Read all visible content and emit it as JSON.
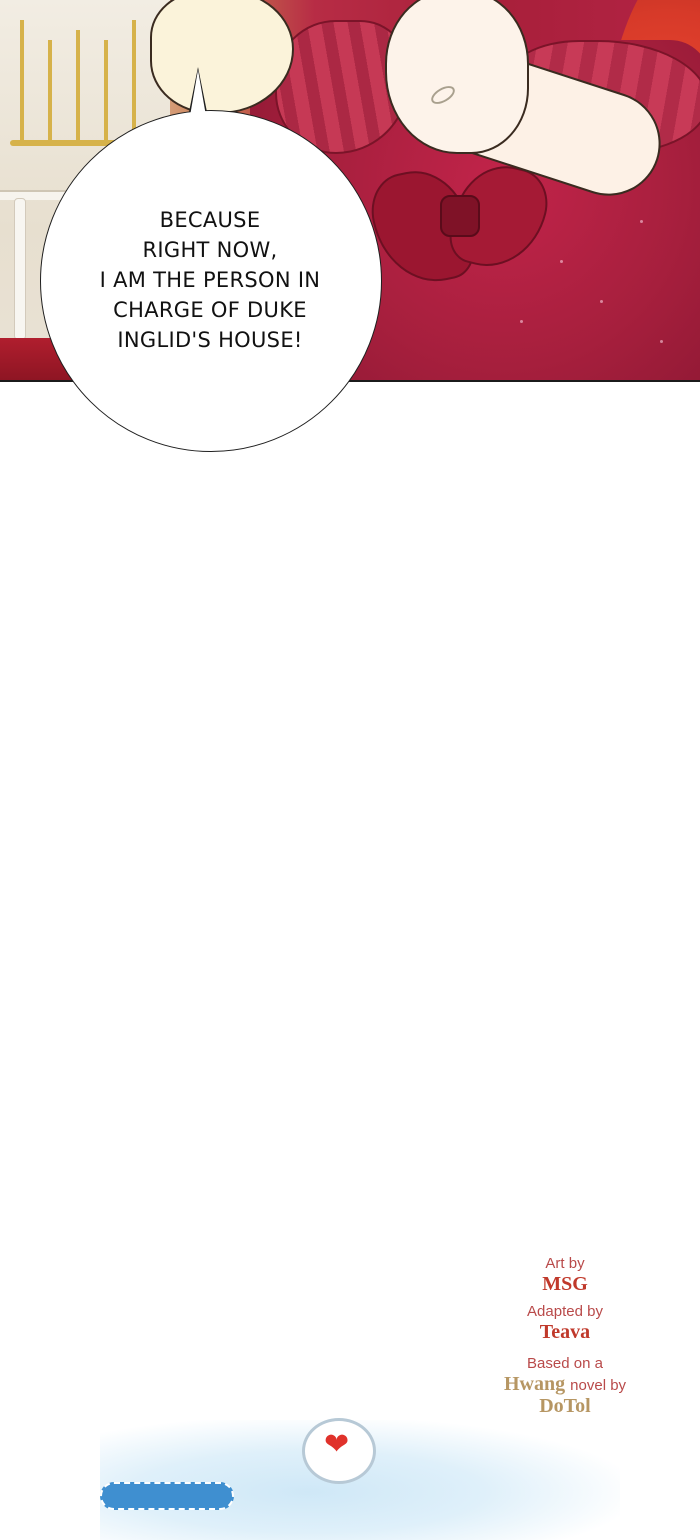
{
  "speech_bubble": {
    "lines": [
      "BECAUSE",
      "RIGHT NOW,",
      "I AM THE PERSON IN",
      "CHARGE OF DUKE",
      "INGLID'S HOUSE!"
    ]
  },
  "credits": {
    "art_label": "Art by",
    "art_name": "MSG",
    "adapted_label": "Adapted by",
    "adapted_name": "Teava",
    "based_label": "Based on a",
    "based_author": "Hwang",
    "based_suffix": "novel by",
    "novel_author": "DoTol"
  },
  "logo": {
    "heart_icon": "heart-icon",
    "heart_color": "#e0322b"
  },
  "colors": {
    "dress": "#a61f3d",
    "credit_red": "#c0392b",
    "credit_gold": "#b69663",
    "logo_blue": "#3f8fd0"
  }
}
